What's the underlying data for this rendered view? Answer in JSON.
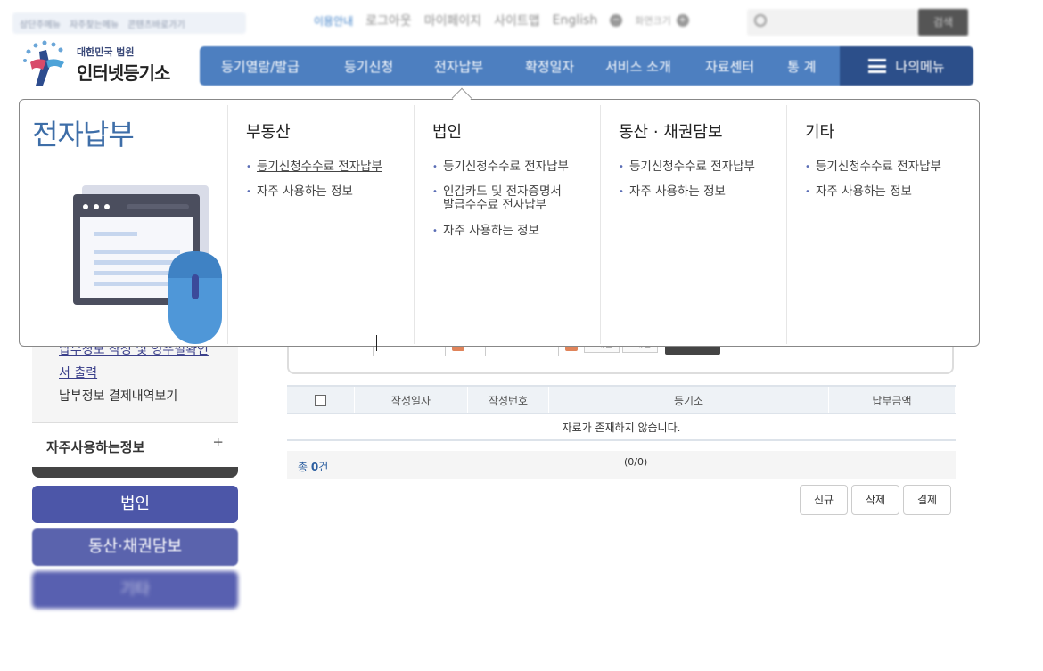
{
  "utility": {
    "left_links": [
      "상단주메뉴",
      "자주찾는메뉴",
      "콘텐츠바로가기"
    ],
    "links": [
      "이용안내",
      "로그아웃",
      "마이페이지",
      "사이트맵",
      "English"
    ],
    "zoom_label": "화면크기",
    "search_placeholder": "",
    "search_button": "검색"
  },
  "logo": {
    "sub": "대한민국 법원",
    "main": "인터넷등기소"
  },
  "gnb": {
    "items": [
      "등기열람/발급",
      "등기신청",
      "전자납부",
      "확정일자",
      "서비스 소개",
      "자료센터",
      "통 계"
    ],
    "my_menu": "나의메뉴"
  },
  "mega": {
    "title": "전자납부",
    "columns": [
      {
        "heading": "부동산",
        "items": [
          "등기신청수수료 전자납부",
          "자주 사용하는 정보"
        ]
      },
      {
        "heading": "법인",
        "items": [
          "등기신청수수료 전자납부",
          "인감카드 및 전자증명서",
          "발급수수료 전자납부",
          "자주 사용하는 정보"
        ]
      },
      {
        "heading": "동산 · 채권담보",
        "items": [
          "등기신청수수료 전자납부",
          "자주 사용하는 정보"
        ]
      },
      {
        "heading": "기타",
        "items": [
          "등기신청수수료 전자납부",
          "자주 사용하는 정보"
        ]
      }
    ]
  },
  "sidebar": {
    "links": [
      "납부정보 작성 및 영수필확인",
      "서 출력",
      "납부정보 결제내역보기"
    ],
    "favorites": "자주사용하는정보",
    "favorites_toggle": "+",
    "buttons": [
      "법인",
      "동산·채권담보",
      "기타"
    ]
  },
  "filter": {
    "btn1": "1개월",
    "btn2": "3개월"
  },
  "table": {
    "headers": [
      "작성일자",
      "작성번호",
      "등기소",
      "납부금액"
    ],
    "empty": "자료가 존재하지 않습니다."
  },
  "summary": {
    "total_prefix": "총 ",
    "total_count": "0",
    "total_suffix": "건",
    "paging": "(0/0)"
  },
  "actions": [
    "신규",
    "삭제",
    "결제"
  ],
  "colors": {
    "nav": "#4d7fc0",
    "nav_dark": "#2c4f8a",
    "title": "#3e6ea8",
    "side_button": "#4c56a8"
  }
}
